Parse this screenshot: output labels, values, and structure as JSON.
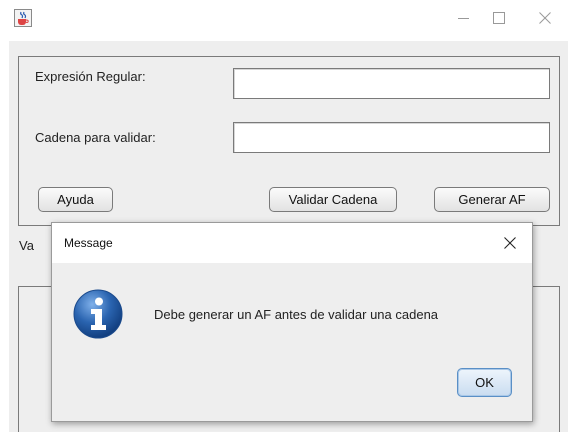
{
  "window": {
    "title": "",
    "icon": "java-coffee-cup-icon",
    "controls": {
      "minimize": "—",
      "maximize": "☐",
      "close": "✕"
    }
  },
  "form": {
    "regex_label": "Expresión Regular:",
    "regex_value": "",
    "string_label": "Cadena para validar:",
    "string_value": "",
    "help_button": "Ayuda",
    "validate_button": "Validar Cadena",
    "generate_button": "Generar AF",
    "partial_label": "Va"
  },
  "dialog": {
    "title": "Message",
    "close": "✕",
    "icon": "info-icon",
    "message": "Debe generar un AF antes de validar una cadena",
    "ok_button": "OK"
  },
  "colors": {
    "background": "#eeeeee",
    "titlebar": "#ffffff",
    "info_icon_blue": "#2a64b0",
    "ok_border": "#5a8fc6"
  }
}
